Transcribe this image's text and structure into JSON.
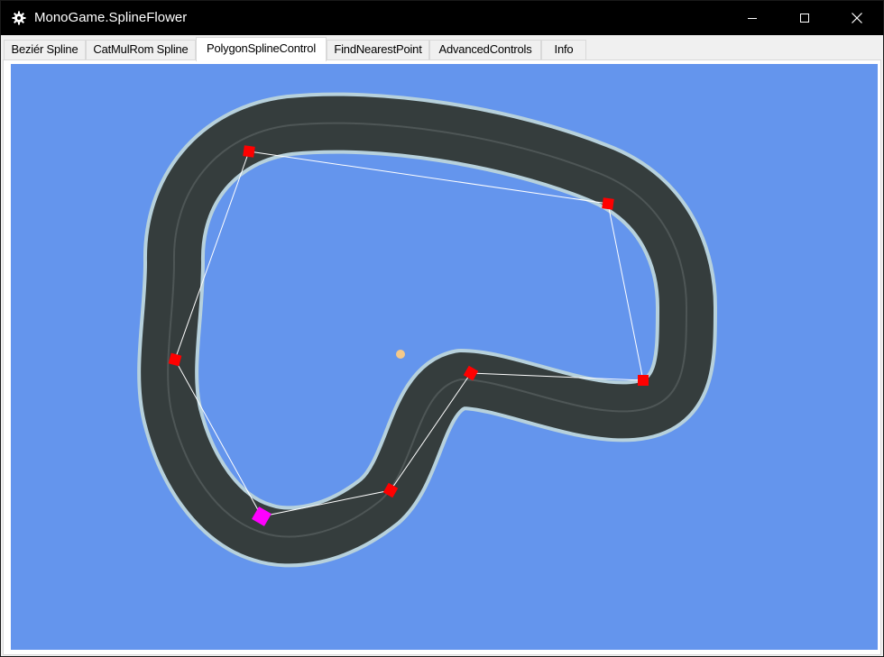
{
  "window": {
    "title": "MonoGame.SplineFlower",
    "app_icon": "gear-icon",
    "controls": {
      "minimize_icon": "minimize-icon",
      "maximize_icon": "maximize-icon",
      "close_icon": "close-icon"
    }
  },
  "tabs": [
    {
      "label": "Beziér Spline",
      "active": false
    },
    {
      "label": "CatMulRom Spline",
      "active": false
    },
    {
      "label": "PolygonSplineControl",
      "active": true
    },
    {
      "label": "FindNearestPoint",
      "active": false
    },
    {
      "label": "AdvancedControls",
      "active": false
    },
    {
      "label": "Info",
      "active": false
    }
  ],
  "viewport": {
    "background_color": "#6495ed",
    "track_color": "#353d3d",
    "track_border_color": "#b7d1dc",
    "track_lane_color": "#4e5656",
    "control_point_color": "#ff0000",
    "selected_point_color": "#ff00ff",
    "center_point_color": "#f5c98a",
    "polygon_line_color": "#ffffff"
  }
}
